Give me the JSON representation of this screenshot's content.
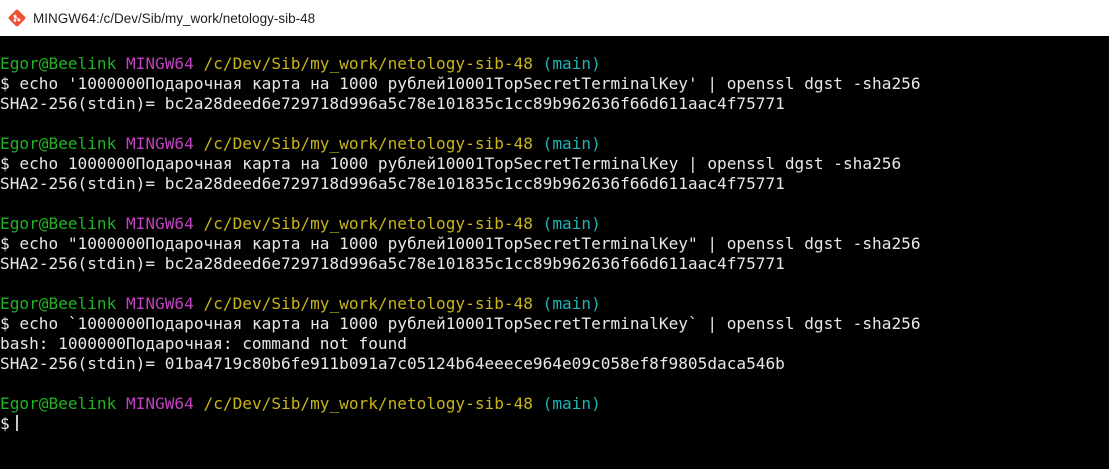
{
  "window": {
    "title": "MINGW64:/c/Dev/Sib/my_work/netology-sib-48",
    "icon": "git-bash-icon"
  },
  "colors": {
    "background": "#000000",
    "text": "#e8e8e8",
    "user": "#22b322",
    "msystem": "#c23fc2",
    "path": "#c8b41c",
    "branch": "#22b2b2"
  },
  "prompt": {
    "user_host": "Egor@Beelink",
    "msystem": "MINGW64",
    "path": "/c/Dev/Sib/my_work/netology-sib-48",
    "branch": "(main)",
    "symbol": "$"
  },
  "blocks": [
    {
      "command": "echo '1000000Подарочная карта на 1000 рублей10001TopSecretTerminalKey' | openssl dgst -sha256",
      "output": [
        "SHA2-256(stdin)= bc2a28deed6e729718d996a5c78e101835c1cc89b962636f66d611aac4f75771"
      ]
    },
    {
      "command": "echo 1000000Подарочная карта на 1000 рублей10001TopSecretTerminalKey | openssl dgst -sha256",
      "output": [
        "SHA2-256(stdin)= bc2a28deed6e729718d996a5c78e101835c1cc89b962636f66d611aac4f75771"
      ]
    },
    {
      "command": "echo \"1000000Подарочная карта на 1000 рублей10001TopSecretTerminalKey\" | openssl dgst -sha256",
      "output": [
        "SHA2-256(stdin)= bc2a28deed6e729718d996a5c78e101835c1cc89b962636f66d611aac4f75771"
      ]
    },
    {
      "command": "echo `1000000Подарочная карта на 1000 рублей10001TopSecretTerminalKey` | openssl dgst -sha256",
      "output": [
        "bash: 1000000Подарочная: command not found",
        "SHA2-256(stdin)= 01ba4719c80b6fe911b091a7c05124b64eeece964e09c058ef8f9805daca546b"
      ]
    }
  ],
  "current_command": ""
}
